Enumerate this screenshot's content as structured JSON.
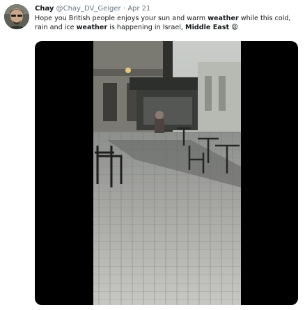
{
  "tweet": {
    "display_name": "Chay",
    "handle": "@Chay_DV_Geiger",
    "separator": "·",
    "date": "Apr 21",
    "text_parts": [
      "Hope you British people enjoys your sun and warm ",
      "weather",
      " while this cold, rain and ice ",
      "weather",
      " is happening in Israel, ",
      "Middle East",
      " "
    ],
    "emoji": "😩",
    "avatar_icon": "user-avatar-photo",
    "media_icon": "video-thumbnail"
  }
}
